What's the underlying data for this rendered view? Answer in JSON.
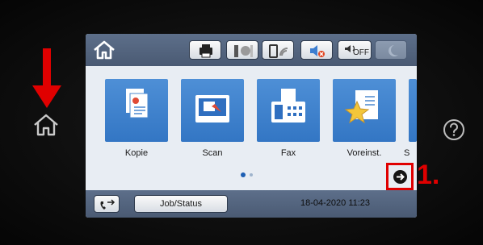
{
  "colors": {
    "bar_top": "#5d6f8a",
    "tile_blue": "#3f82cd",
    "annotation_red": "#e00000",
    "active_dot": "#1e5fb3",
    "inactive_dot": "#9fb4cc"
  },
  "statusbar": {
    "home_icon": "home-icon",
    "buttons": [
      {
        "icon": "printer-icon"
      },
      {
        "icon": "ink-status-icon"
      },
      {
        "icon": "wifi-icon"
      },
      {
        "icon": "mute-icon"
      },
      {
        "icon": "sound-off-icon",
        "label": "OFF"
      },
      {
        "icon": "moon-icon"
      }
    ]
  },
  "tiles": [
    {
      "label": "Kopie",
      "icon": "copy-icon"
    },
    {
      "label": "Scan",
      "icon": "scan-icon"
    },
    {
      "label": "Fax",
      "icon": "fax-icon"
    },
    {
      "label": "Voreinst.",
      "icon": "presets-icon"
    },
    {
      "label": "S",
      "icon": "partial-tile-icon"
    }
  ],
  "page_indicator": {
    "pages": 2,
    "current": 1
  },
  "bottombar": {
    "job_status_label": "Job/Status",
    "datetime": "18-04-2020 11:23"
  },
  "annotation": {
    "step_label": "1."
  }
}
